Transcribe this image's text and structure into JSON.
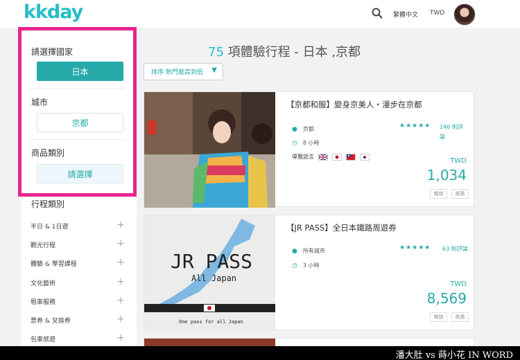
{
  "header": {
    "logo": "kkday",
    "language": "繁體中文",
    "currency": "TWD"
  },
  "filters": {
    "country_label": "請選擇國家",
    "country_value": "日本",
    "city_label": "城市",
    "city_value": "京都",
    "product_label": "商品類別",
    "product_value": "請選擇"
  },
  "categories": {
    "title": "行程類別",
    "items": [
      "半日 & 1日遊",
      "觀光行程",
      "體驗 & 學習課程",
      "文化藝術",
      "租車服務",
      "票券 & 兌換券",
      "包車旅遊"
    ]
  },
  "results": {
    "count": "75",
    "title_text": "項體驗行程 - 日本 ,京都",
    "sort_label": "排序 熱門度高到低"
  },
  "cards": [
    {
      "title": "【京都和服】變身京美人・漫步在京都",
      "location": "京都",
      "duration": "8 小時",
      "rating_stars": "★★★★★",
      "reviews": "246 則評論",
      "guide_label": "導覽語言",
      "currency": "TWD",
      "price": "1,034",
      "tag1": "暢銷",
      "tag2": "推薦"
    },
    {
      "title": "【JR PASS】全日本鐵路周遊券",
      "location": "所有城市",
      "duration": "3 小時",
      "rating_stars": "★★★★★",
      "reviews": "63 則評論",
      "currency": "TWD",
      "price": "8,569",
      "tag1": "暢銷",
      "tag2": "推薦",
      "image_title": "JR PASS",
      "image_subtitle": "All Japan",
      "image_caption": "One pass for all Japan"
    }
  ],
  "watermark": "潘大肚 vs 蒔小花 IN WORD",
  "colors": {
    "accent": "#26a9a9",
    "logo": "#26bec9",
    "highlight_border": "#e8248f"
  }
}
